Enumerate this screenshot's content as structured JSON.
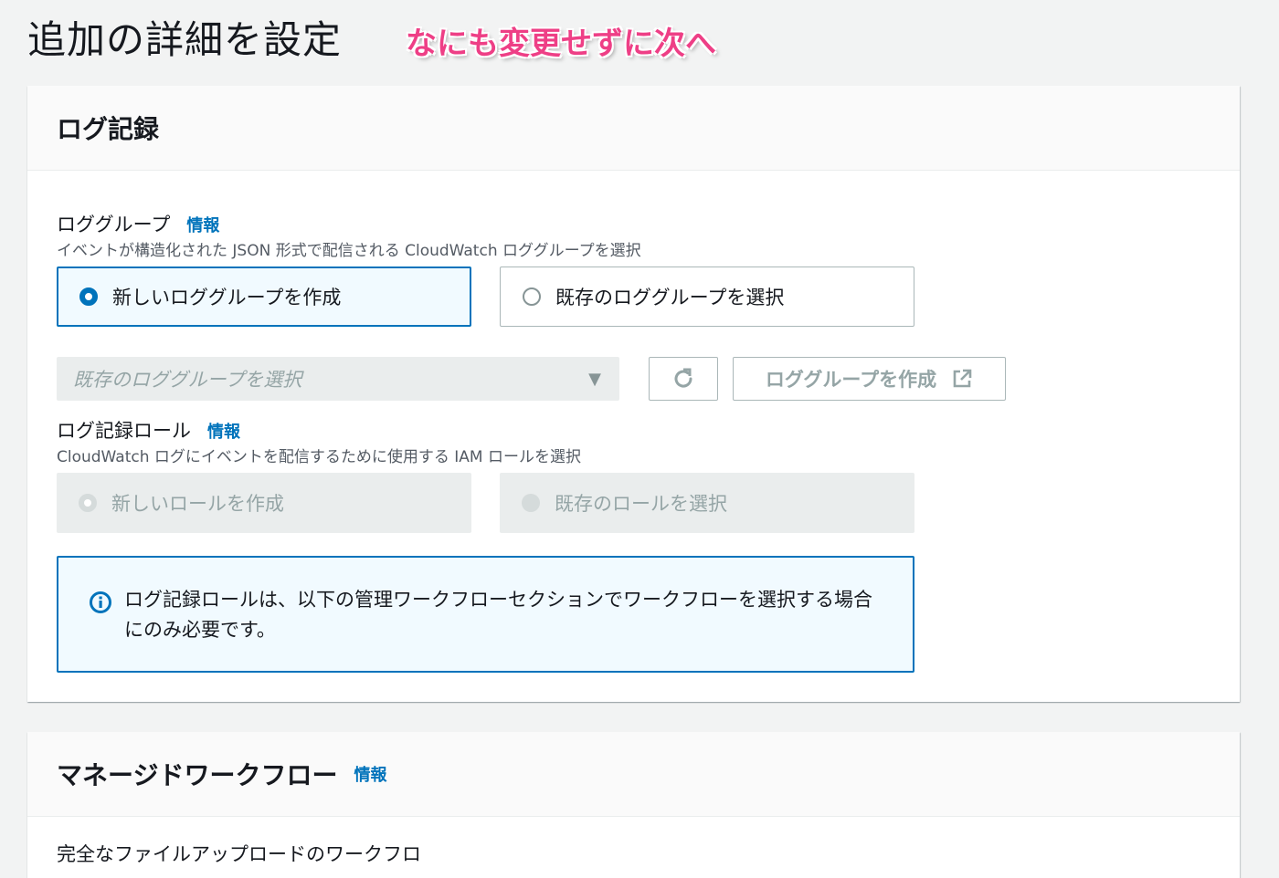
{
  "page": {
    "title": "追加の詳細を設定",
    "annotation": "なにも変更せずに次へ"
  },
  "logging_card": {
    "title": "ログ記録",
    "log_group": {
      "label": "ロググループ",
      "info": "情報",
      "description": "イベントが構造化された JSON 形式で配信される CloudWatch ロググループを選択",
      "options": [
        {
          "label": "新しいロググループを作成",
          "selected": true
        },
        {
          "label": "既存のロググループを選択",
          "selected": false
        }
      ],
      "select_placeholder": "既存のロググループを選択",
      "create_button": "ロググループを作成"
    },
    "role": {
      "label": "ログ記録ロール",
      "info": "情報",
      "description": "CloudWatch ログにイベントを配信するために使用する IAM ロールを選択",
      "options": [
        {
          "label": "新しいロールを作成",
          "selected": true,
          "disabled": true
        },
        {
          "label": "既存のロールを選択",
          "selected": false,
          "disabled": true
        }
      ]
    },
    "alert": {
      "icon": "info-icon",
      "text": "ログ記録ロールは、以下の管理ワークフローセクションでワークフローを選択する場合にのみ必要です。"
    }
  },
  "workflow_card": {
    "title": "マネージドワークフロー",
    "info": "情報",
    "body_text": "完全なファイルアップロードのワークフロ"
  },
  "colors": {
    "accent": "#0073bb",
    "annotation": "#ee3f86",
    "background": "#f2f3f3"
  }
}
